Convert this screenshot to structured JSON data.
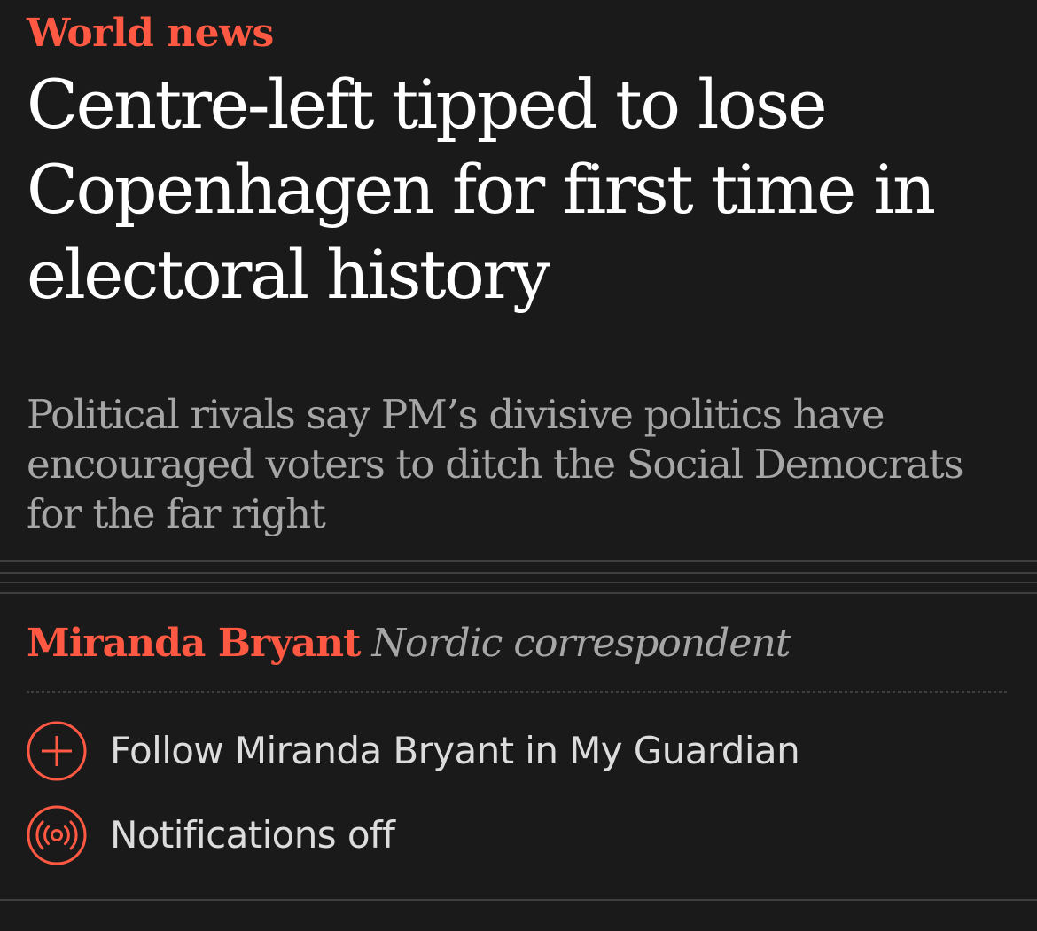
{
  "article": {
    "section": "World news",
    "headline": "Centre-left tipped to lose Copenhagen for first time in electoral history",
    "standfirst": "Political rivals say PM’s divisive politics have encouraged voters to ditch the Social Democrats for the far right"
  },
  "byline": {
    "author": "Miranda Bryant",
    "role": "Nordic correspondent"
  },
  "actions": {
    "follow": {
      "label": "Follow Miranda Bryant in My Guardian",
      "icon": "plus-icon"
    },
    "notifications": {
      "label": "Notifications off",
      "icon": "broadcast-icon"
    }
  },
  "colors": {
    "background": "#1a1a1a",
    "accent": "#ff5943",
    "headline": "#ffffff",
    "standfirst": "#a6a6a6",
    "action_text": "#dcdcdc",
    "rule": "#3f3f3f"
  }
}
